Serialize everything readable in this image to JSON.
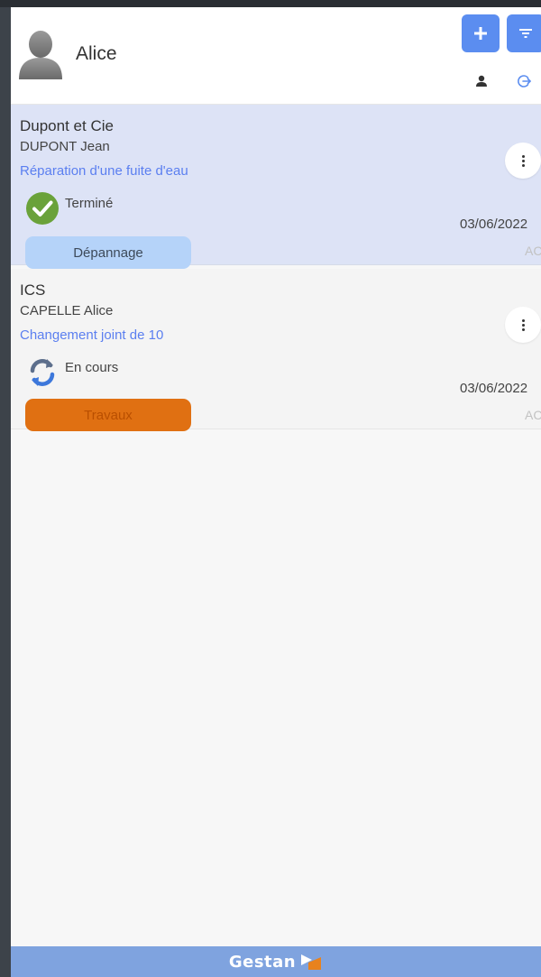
{
  "header": {
    "user_name": "Alice",
    "icons": {
      "avatar": "user-avatar-icon",
      "add": "plus-icon",
      "filter": "filter-icon",
      "profile": "user-icon",
      "logout": "logout-icon"
    }
  },
  "interventions": [
    {
      "company": "Dupont et Cie",
      "contact": "DUPONT Jean",
      "subject": "Réparation d'une fuite d'eau",
      "status": "Terminé",
      "status_icon": "check-circle-icon",
      "type": "Dépannage",
      "date": "03/06/2022",
      "initials": "AC"
    },
    {
      "company": "ICS",
      "contact": "CAPELLE Alice",
      "subject": "Changement joint de 10",
      "status": "En cours",
      "status_icon": "sync-icon",
      "type": "Travaux",
      "date": "03/06/2022",
      "initials": "AC"
    }
  ],
  "footer": {
    "brand": "Gestan"
  },
  "colors": {
    "accent": "#5b8df0",
    "selected_row": "#dde3f6",
    "link": "#5b7ff0",
    "status_done": "#6aa23a",
    "status_in_progress": "#4a78d6",
    "badge_depannage": "#b5d3f9",
    "badge_travaux": "#e07012",
    "footer": "#7fa3df"
  }
}
